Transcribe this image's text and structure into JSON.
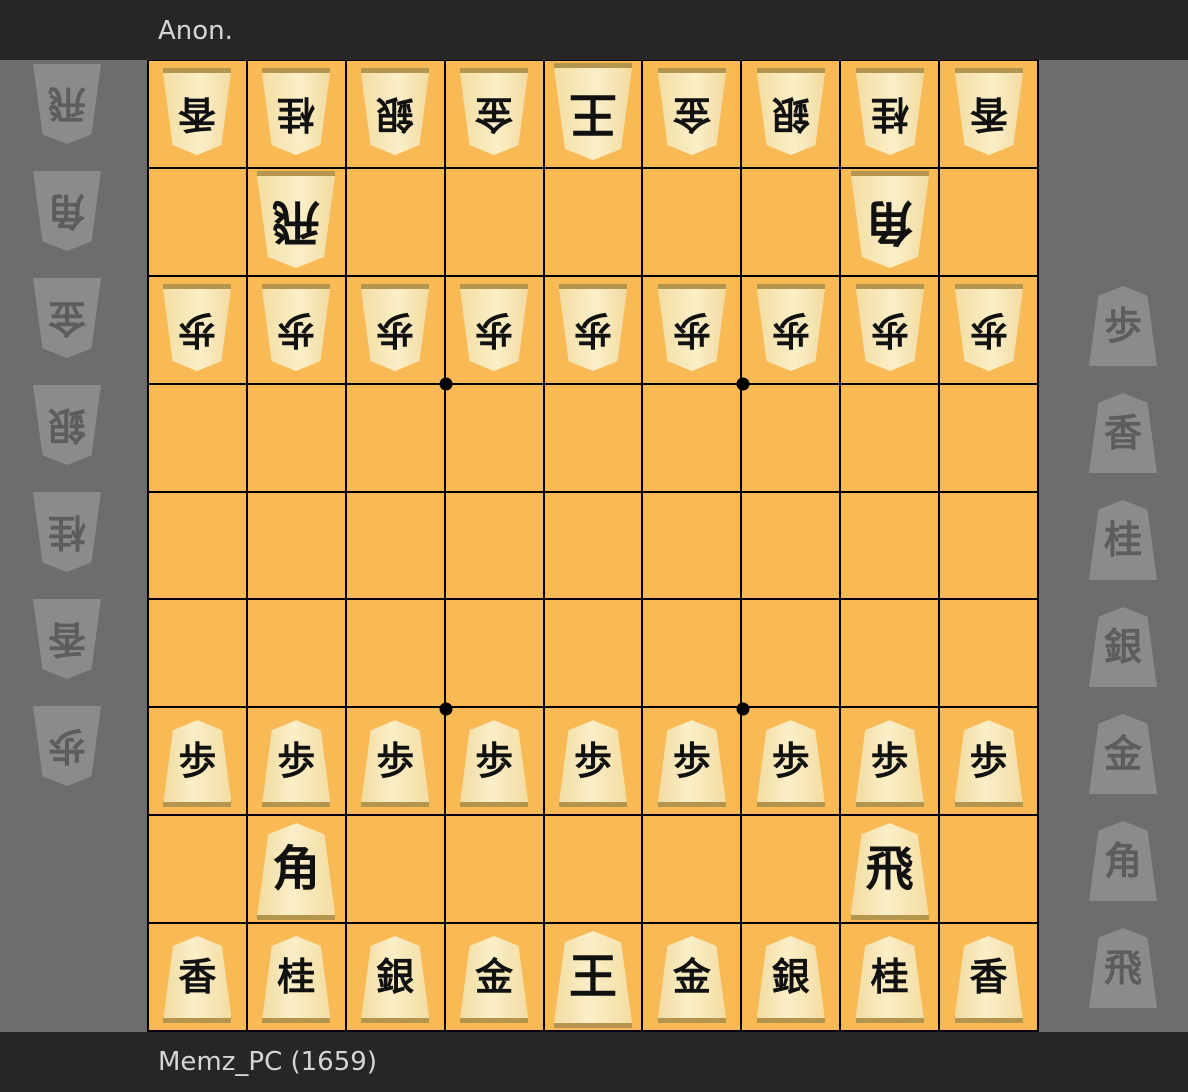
{
  "players": {
    "top": {
      "name": "Anon."
    },
    "bottom": {
      "name": "Memz_PC (1659)"
    }
  },
  "colors": {
    "board": "#f9b955",
    "bar": "#282625",
    "background": "#6d6e6c"
  },
  "board": {
    "files": 9,
    "ranks": 9,
    "pieces": [
      {
        "row": 0,
        "col": 0,
        "ch": "香",
        "side": "gote"
      },
      {
        "row": 0,
        "col": 1,
        "ch": "桂",
        "side": "gote"
      },
      {
        "row": 0,
        "col": 2,
        "ch": "銀",
        "side": "gote"
      },
      {
        "row": 0,
        "col": 3,
        "ch": "金",
        "side": "gote"
      },
      {
        "row": 0,
        "col": 4,
        "ch": "王",
        "side": "gote",
        "big": true
      },
      {
        "row": 0,
        "col": 5,
        "ch": "金",
        "side": "gote"
      },
      {
        "row": 0,
        "col": 6,
        "ch": "銀",
        "side": "gote"
      },
      {
        "row": 0,
        "col": 7,
        "ch": "桂",
        "side": "gote"
      },
      {
        "row": 0,
        "col": 8,
        "ch": "香",
        "side": "gote"
      },
      {
        "row": 1,
        "col": 1,
        "ch": "飛",
        "side": "gote",
        "big": true
      },
      {
        "row": 1,
        "col": 7,
        "ch": "角",
        "side": "gote",
        "big": true
      },
      {
        "row": 2,
        "col": 0,
        "ch": "歩",
        "side": "gote"
      },
      {
        "row": 2,
        "col": 1,
        "ch": "歩",
        "side": "gote"
      },
      {
        "row": 2,
        "col": 2,
        "ch": "歩",
        "side": "gote"
      },
      {
        "row": 2,
        "col": 3,
        "ch": "歩",
        "side": "gote"
      },
      {
        "row": 2,
        "col": 4,
        "ch": "歩",
        "side": "gote"
      },
      {
        "row": 2,
        "col": 5,
        "ch": "歩",
        "side": "gote"
      },
      {
        "row": 2,
        "col": 6,
        "ch": "歩",
        "side": "gote"
      },
      {
        "row": 2,
        "col": 7,
        "ch": "歩",
        "side": "gote"
      },
      {
        "row": 2,
        "col": 8,
        "ch": "歩",
        "side": "gote"
      },
      {
        "row": 6,
        "col": 0,
        "ch": "歩",
        "side": "sente"
      },
      {
        "row": 6,
        "col": 1,
        "ch": "歩",
        "side": "sente"
      },
      {
        "row": 6,
        "col": 2,
        "ch": "歩",
        "side": "sente"
      },
      {
        "row": 6,
        "col": 3,
        "ch": "歩",
        "side": "sente"
      },
      {
        "row": 6,
        "col": 4,
        "ch": "歩",
        "side": "sente"
      },
      {
        "row": 6,
        "col": 5,
        "ch": "歩",
        "side": "sente"
      },
      {
        "row": 6,
        "col": 6,
        "ch": "歩",
        "side": "sente"
      },
      {
        "row": 6,
        "col": 7,
        "ch": "歩",
        "side": "sente"
      },
      {
        "row": 6,
        "col": 8,
        "ch": "歩",
        "side": "sente"
      },
      {
        "row": 7,
        "col": 1,
        "ch": "角",
        "side": "sente",
        "big": true
      },
      {
        "row": 7,
        "col": 7,
        "ch": "飛",
        "side": "sente",
        "big": true
      },
      {
        "row": 8,
        "col": 0,
        "ch": "香",
        "side": "sente"
      },
      {
        "row": 8,
        "col": 1,
        "ch": "桂",
        "side": "sente"
      },
      {
        "row": 8,
        "col": 2,
        "ch": "銀",
        "side": "sente"
      },
      {
        "row": 8,
        "col": 3,
        "ch": "金",
        "side": "sente"
      },
      {
        "row": 8,
        "col": 4,
        "ch": "王",
        "side": "sente",
        "big": true
      },
      {
        "row": 8,
        "col": 5,
        "ch": "金",
        "side": "sente"
      },
      {
        "row": 8,
        "col": 6,
        "ch": "銀",
        "side": "sente"
      },
      {
        "row": 8,
        "col": 7,
        "ch": "桂",
        "side": "sente"
      },
      {
        "row": 8,
        "col": 8,
        "ch": "香",
        "side": "sente"
      }
    ]
  },
  "hands": {
    "gote": [
      "飛",
      "角",
      "金",
      "銀",
      "桂",
      "香",
      "歩"
    ],
    "sente": [
      "歩",
      "香",
      "桂",
      "銀",
      "金",
      "角",
      "飛"
    ]
  }
}
